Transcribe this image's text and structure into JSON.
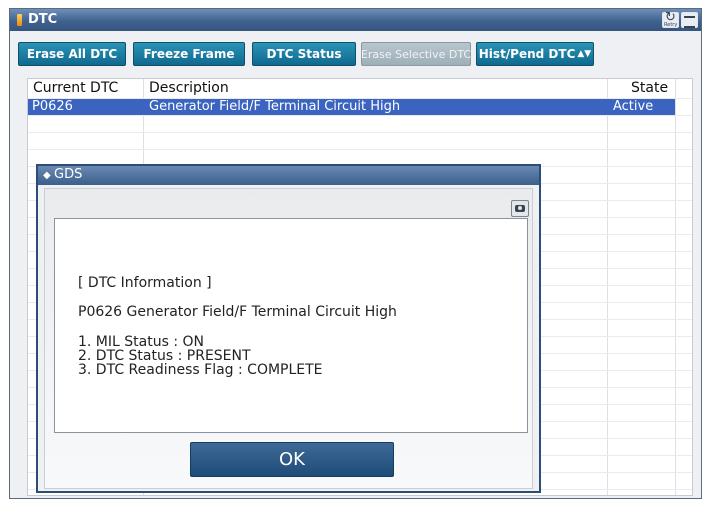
{
  "window": {
    "title": "DTC"
  },
  "toolbar": {
    "buttons": [
      {
        "label": "Erase All DTC",
        "enabled": true
      },
      {
        "label": "Freeze Frame",
        "enabled": true
      },
      {
        "label": "DTC Status",
        "enabled": true
      },
      {
        "label": "Erase Selective DTC",
        "enabled": false
      },
      {
        "label": "Hist/Pend DTC",
        "enabled": true
      }
    ]
  },
  "table": {
    "headers": {
      "code": "Current DTC",
      "description": "Description",
      "state": "State"
    },
    "rows": [
      {
        "code": "P0626",
        "description": "Generator Field/F Terminal Circuit High",
        "state": "Active",
        "selected": true
      }
    ]
  },
  "dialog": {
    "title": "GDS",
    "heading": "[ DTC Information ]",
    "dtc_line": "P0626 Generator Field/F Terminal Circuit High",
    "status_lines": [
      "1. MIL Status : ON",
      "2. DTC Status : PRESENT",
      "3. DTC Readiness Flag : COMPLETE"
    ],
    "ok_label": "OK"
  },
  "colors": {
    "selection": "#3a64c0",
    "toolbar_button": "#10698f",
    "title_bar": "#3f628f"
  },
  "icons": {
    "retry": "retry-icon",
    "layout": "layout-icon",
    "camera": "camera-icon"
  }
}
